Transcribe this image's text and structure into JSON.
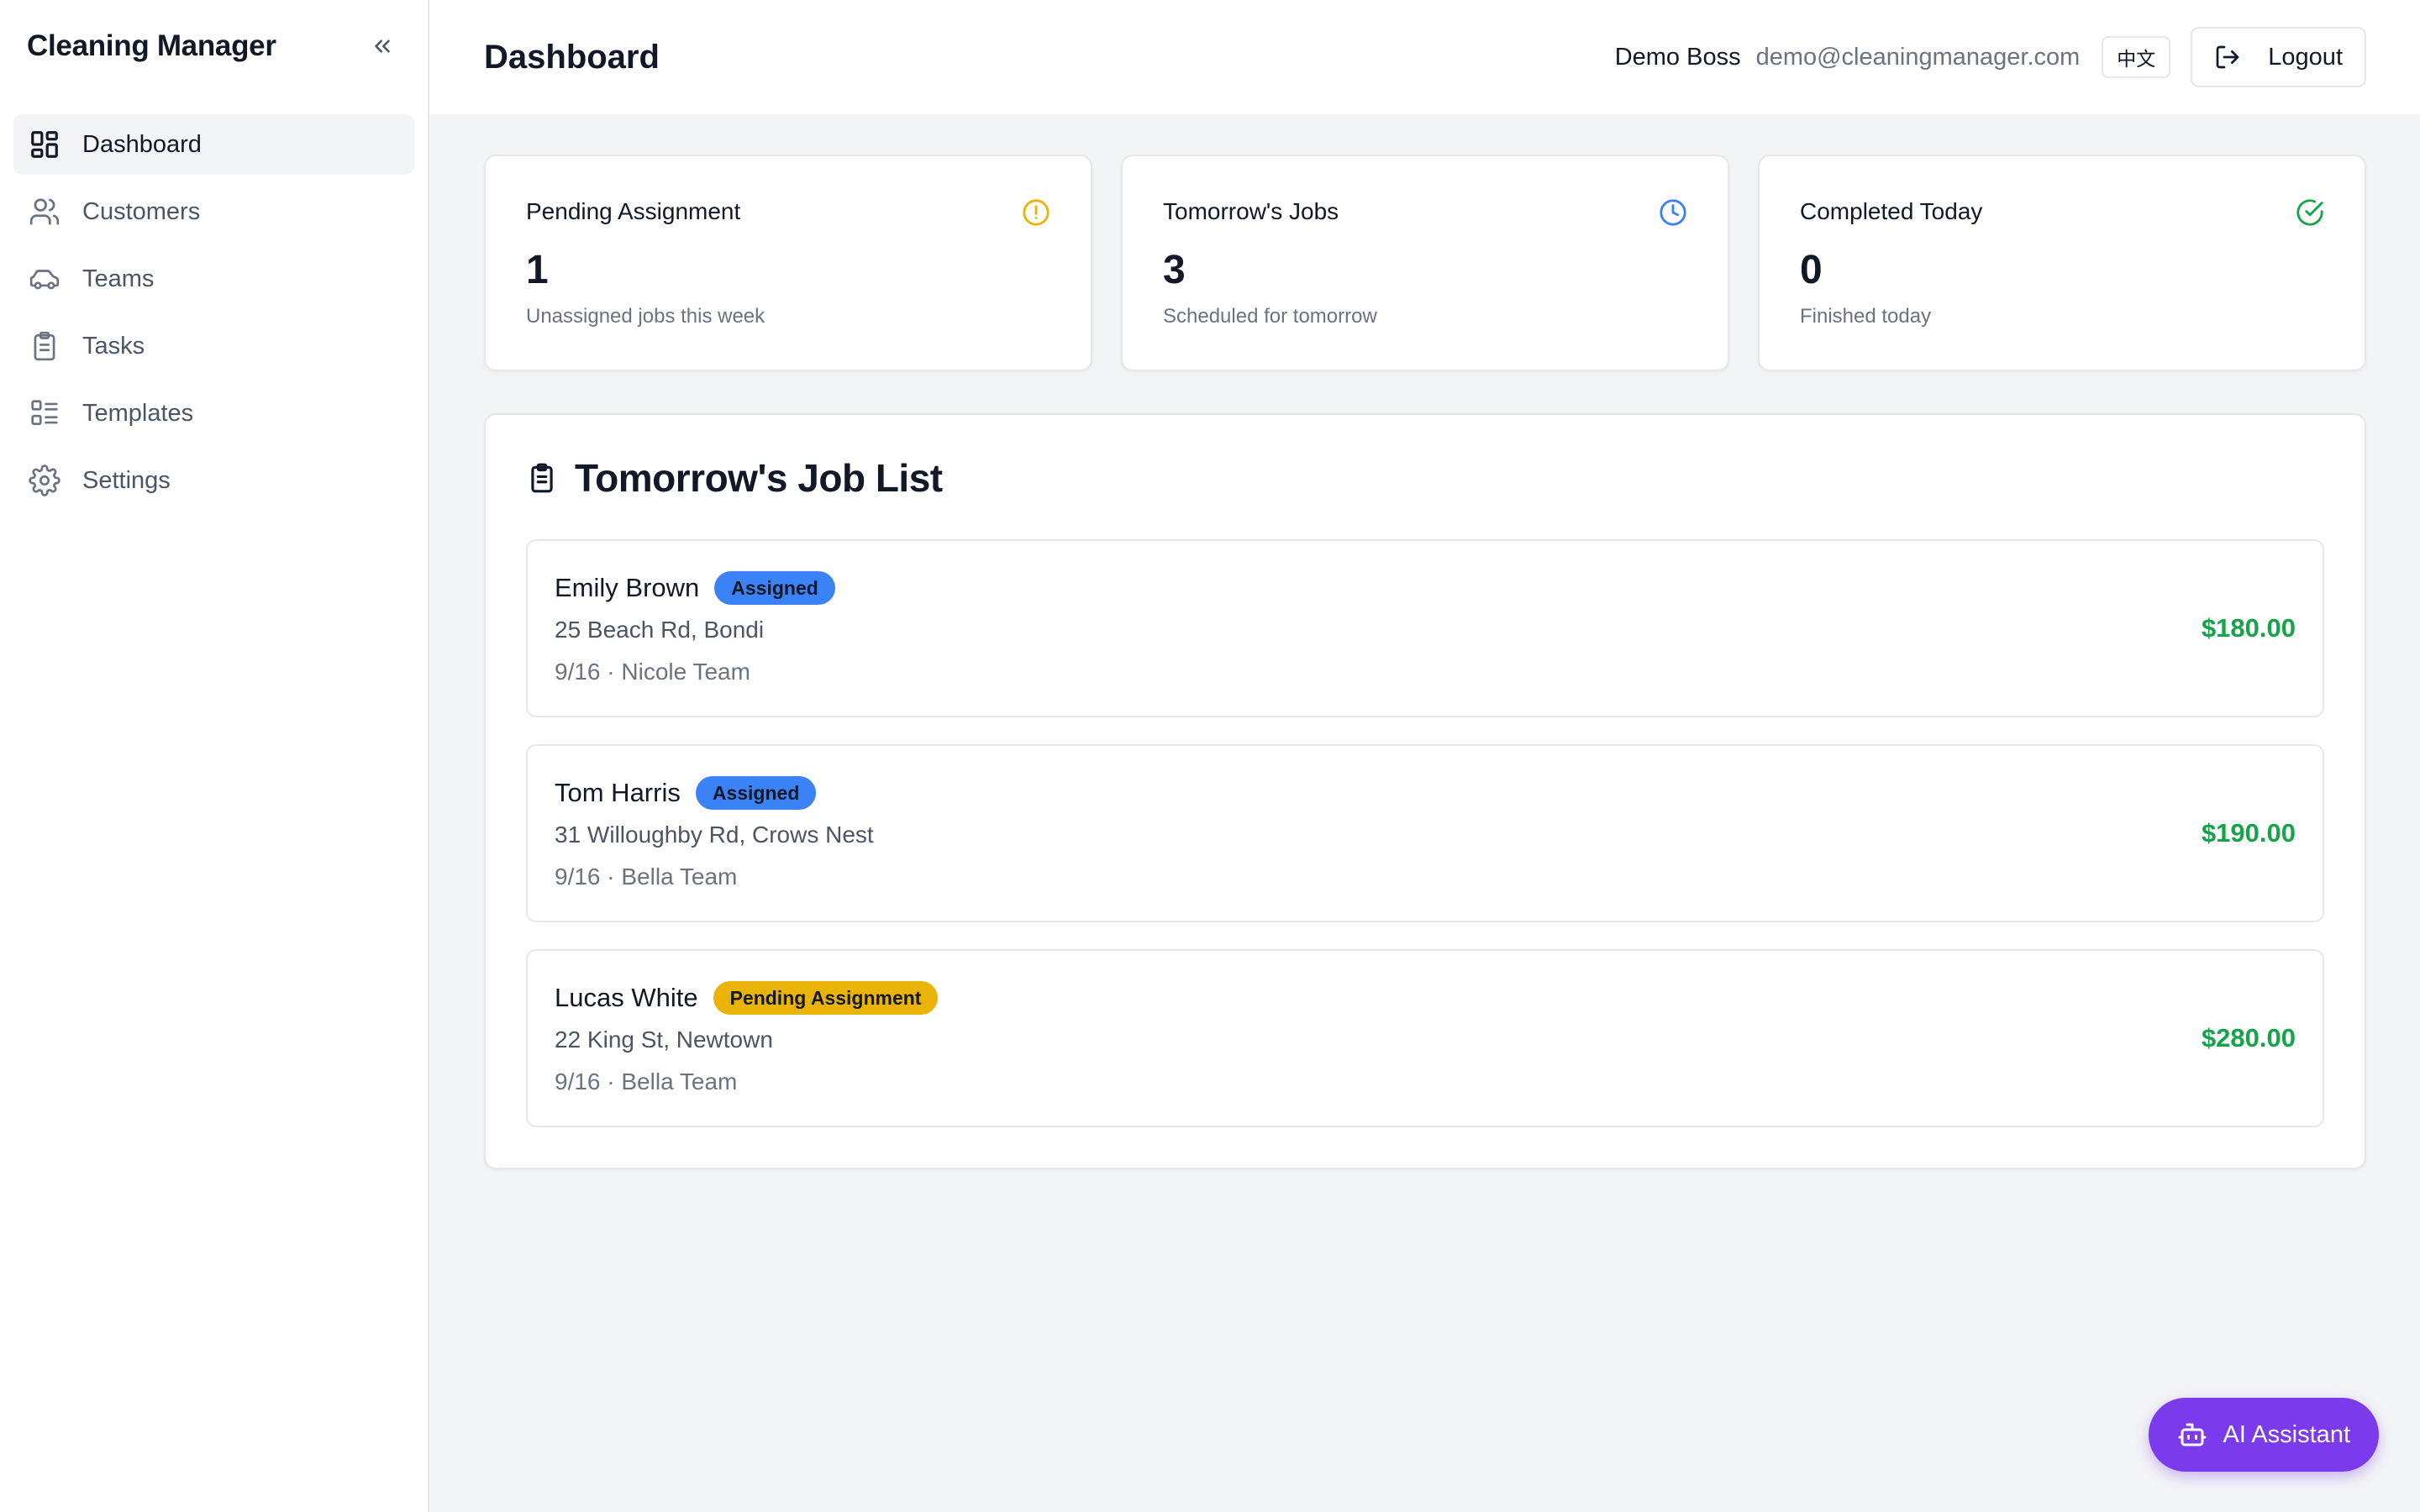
{
  "app": {
    "brand": "Cleaning Manager"
  },
  "sidebar": {
    "items": [
      {
        "label": "Dashboard",
        "icon": "dashboard-icon",
        "active": true
      },
      {
        "label": "Customers",
        "icon": "users-icon"
      },
      {
        "label": "Teams",
        "icon": "car-icon"
      },
      {
        "label": "Tasks",
        "icon": "clipboard-icon"
      },
      {
        "label": "Templates",
        "icon": "list-icon"
      },
      {
        "label": "Settings",
        "icon": "gear-icon"
      }
    ]
  },
  "header": {
    "title": "Dashboard",
    "user_name": "Demo Boss",
    "user_email": "demo@cleaningmanager.com",
    "lang_label": "中文",
    "logout_label": "Logout"
  },
  "stats": [
    {
      "title": "Pending Assignment",
      "value": "1",
      "sub": "Unassigned jobs this week",
      "icon": "alert-circle-icon",
      "color": "#eab308"
    },
    {
      "title": "Tomorrow's Jobs",
      "value": "3",
      "sub": "Scheduled for tomorrow",
      "icon": "clock-icon",
      "color": "#3b82f6"
    },
    {
      "title": "Completed Today",
      "value": "0",
      "sub": "Finished today",
      "icon": "check-circle-icon",
      "color": "#16a34a"
    }
  ],
  "job_list": {
    "title": "Tomorrow's Job List",
    "jobs": [
      {
        "name": "Emily Brown",
        "status": "Assigned",
        "address": "25 Beach Rd, Bondi",
        "meta": "9/16 · Nicole Team",
        "price": "$180.00"
      },
      {
        "name": "Tom Harris",
        "status": "Assigned",
        "address": "31 Willoughby Rd, Crows Nest",
        "meta": "9/16 · Bella Team",
        "price": "$190.00"
      },
      {
        "name": "Lucas White",
        "status": "Pending Assignment",
        "address": "22 King St, Newtown",
        "meta": "9/16 · Bella Team",
        "price": "$280.00"
      }
    ]
  },
  "ai_assistant": {
    "label": "AI Assistant"
  },
  "colors": {
    "accent_purple": "#7c3aed",
    "assigned_blue": "#3b82f6",
    "pending_yellow": "#eab308",
    "price_green": "#16a34a"
  }
}
